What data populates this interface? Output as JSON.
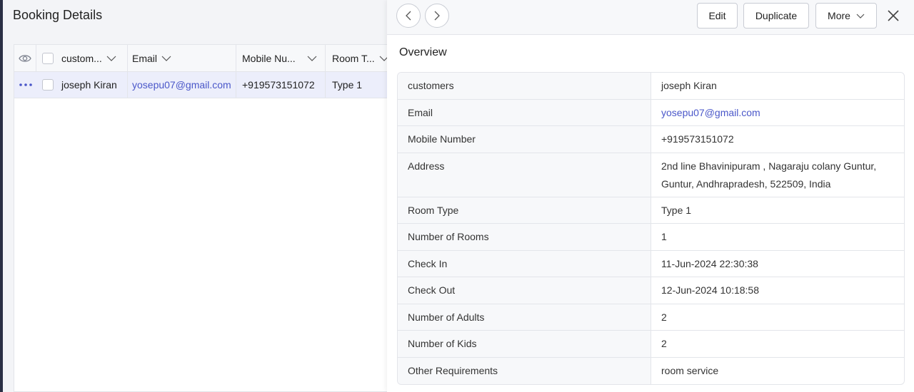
{
  "page": {
    "title": "Booking Details"
  },
  "table": {
    "columns": [
      {
        "label": "custom..."
      },
      {
        "label": "Email"
      },
      {
        "label": "Mobile Nu..."
      },
      {
        "label": "Room T..."
      }
    ],
    "rows": [
      {
        "customer": "joseph Kiran",
        "email": "yosepu07@gmail.com",
        "mobile": "+919573151072",
        "room_type": "Type 1"
      }
    ]
  },
  "detail": {
    "toolbar": {
      "edit": "Edit",
      "duplicate": "Duplicate",
      "more": "More"
    },
    "section_title": "Overview",
    "fields": [
      {
        "label": "customers",
        "value": "joseph Kiran"
      },
      {
        "label": "Email",
        "value": "yosepu07@gmail.com"
      },
      {
        "label": "Mobile Number",
        "value": "+919573151072"
      },
      {
        "label": "Address",
        "value": "2nd line Bhavinipuram , Nagaraju colany Guntur, Guntur, Andhrapradesh, 522509, India"
      },
      {
        "label": "Room Type",
        "value": "Type 1"
      },
      {
        "label": "Number of Rooms",
        "value": "1"
      },
      {
        "label": "Check In",
        "value": "11-Jun-2024 22:30:38"
      },
      {
        "label": "Check Out",
        "value": "12-Jun-2024 10:18:58"
      },
      {
        "label": "Number of Adults",
        "value": "2"
      },
      {
        "label": "Number of Kids",
        "value": "2"
      },
      {
        "label": "Other Requirements",
        "value": "room service"
      }
    ]
  },
  "icons": {
    "view": "eye-icon",
    "row_menu": "more-dots-icon",
    "sort": "chevron-down-icon",
    "prev": "chevron-left-icon",
    "next": "chevron-right-icon",
    "close": "close-icon"
  },
  "colors": {
    "accent": "#4a57c9",
    "sidebar_edge": "#2a2f45",
    "row_highlight": "#eceefb"
  }
}
